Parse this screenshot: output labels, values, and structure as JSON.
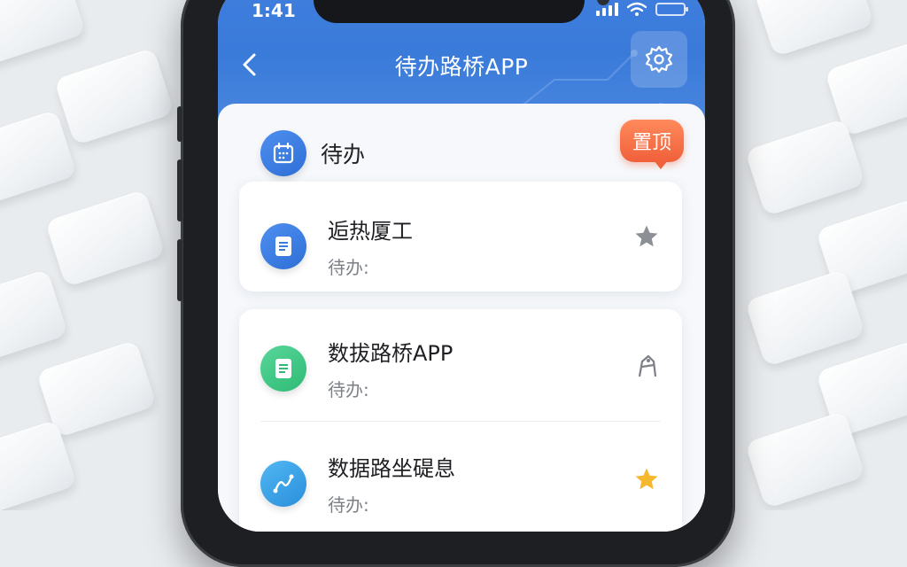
{
  "status_bar": {
    "time": "1:41"
  },
  "nav": {
    "title": "待办路桥APP"
  },
  "section": {
    "title": "待办",
    "badge": "置顶"
  },
  "items": [
    {
      "title": "逅热厦工",
      "subtitle": "待办:",
      "action_icon": "star-icon"
    },
    {
      "title": "数拔路桥APP",
      "subtitle": "待办:",
      "action_icon": "figure-icon"
    },
    {
      "title": "数据路坐碮息",
      "subtitle": "待办:",
      "action_icon": "star-icon"
    }
  ],
  "colors": {
    "header": "#3a7ad9",
    "badge": "#f0603a",
    "star_gray": "#8c9096",
    "star_gold": "#f5b82e"
  }
}
